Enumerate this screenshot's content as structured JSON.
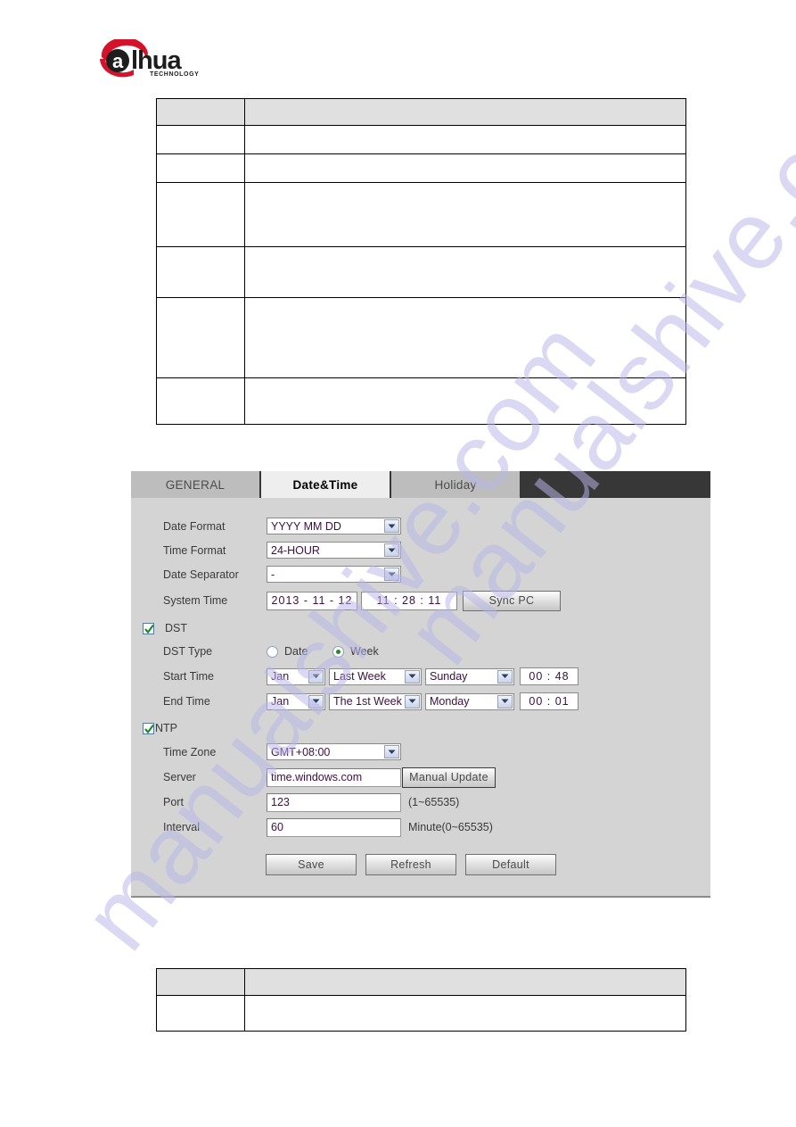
{
  "brand": {
    "name": "alhua",
    "tagline": "TECHNOLOGY"
  },
  "watermark": {
    "text": "manualshive.com"
  },
  "doc_tables": {
    "top": {
      "name": "parameter-description-table",
      "columns": [
        "",
        ""
      ],
      "rows": [
        [
          "",
          ""
        ],
        [
          "",
          ""
        ],
        [
          "",
          ""
        ],
        [
          "",
          ""
        ],
        [
          "",
          ""
        ],
        [
          "",
          ""
        ]
      ]
    },
    "bottom": {
      "name": "parameter-description-table",
      "columns": [
        "",
        ""
      ],
      "rows": [
        [
          "",
          ""
        ]
      ]
    }
  },
  "panel": {
    "tabs": [
      {
        "label": "GENERAL",
        "active": false
      },
      {
        "label": "Date&Time",
        "active": true
      },
      {
        "label": "Holiday",
        "active": false
      }
    ],
    "fields": {
      "date_format": {
        "label": "Date Format",
        "value": "YYYY MM DD"
      },
      "time_format": {
        "label": "Time Format",
        "value": "24-HOUR"
      },
      "date_separator": {
        "label": "Date Separator",
        "value": "-"
      },
      "system_time": {
        "label": "System Time",
        "date": "2013 -  11 -  12",
        "time": "11  :   28   :   11",
        "sync_button": "Sync PC"
      },
      "dst": {
        "label": "DST",
        "checked": true,
        "type_label": "DST Type",
        "type_options": [
          "Date",
          "Week"
        ],
        "type_selected": "Week",
        "start": {
          "label": "Start Time",
          "month": "Jan",
          "week": "Last Week",
          "day": "Sunday",
          "time": "00  :  48"
        },
        "end": {
          "label": "End Time",
          "month": "Jan",
          "week": "The 1st Week",
          "day": "Monday",
          "time": "00  :  01"
        }
      },
      "ntp": {
        "label": "NTP",
        "checked": true,
        "time_zone": {
          "label": "Time Zone",
          "value": "GMT+08:00"
        },
        "server": {
          "label": "Server",
          "value": "time.windows.com",
          "button": "Manual Update"
        },
        "port": {
          "label": "Port",
          "value": "123",
          "hint": "(1~65535)"
        },
        "interval": {
          "label": "Interval",
          "value": "60",
          "hint": "Minute(0~65535)"
        }
      }
    },
    "actions": {
      "save": "Save",
      "refresh": "Refresh",
      "default": "Default"
    },
    "colors": {
      "panel_bg": "#d4d4d4",
      "tabbar_bg": "#373737",
      "tab_inactive": "#bdbdbd",
      "tab_active": "#eeeeee",
      "input_text": "#3c1040",
      "watermark": "#b9b6e8",
      "logo_red": "#d4122a"
    }
  }
}
